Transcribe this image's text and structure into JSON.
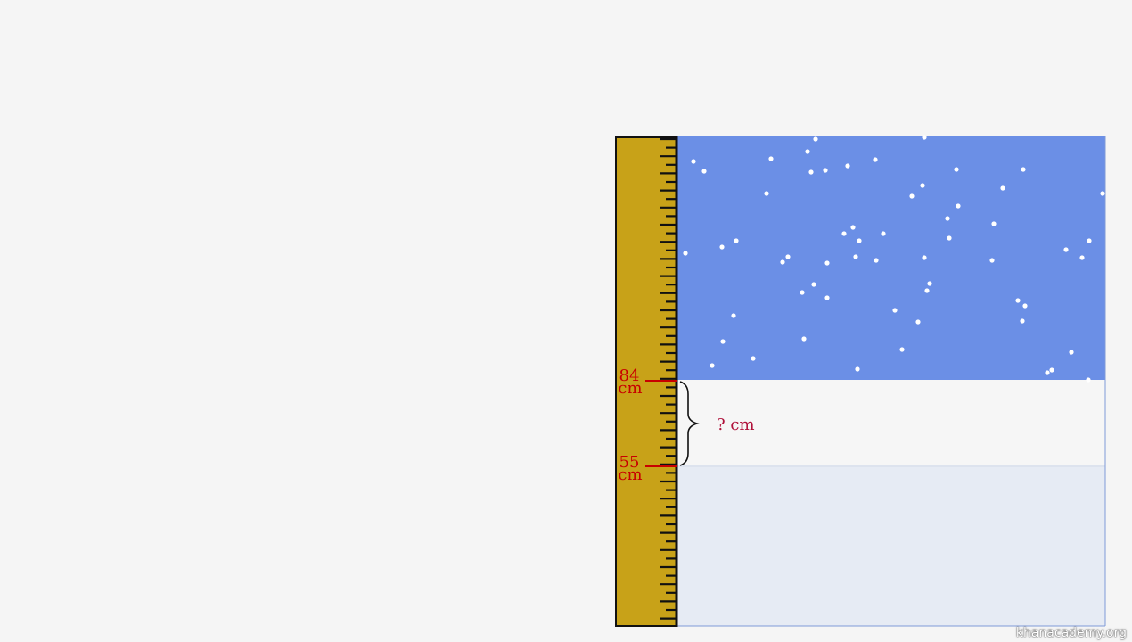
{
  "colors": {
    "background": "#f5f5f5",
    "ruler": "#c8a218",
    "ruler_edge": "#111111",
    "sky": "#6b8fe6",
    "snow_new": "#f6f6f6",
    "snow_old": "#e6ebf4",
    "snowflake": "#ffffff",
    "label_red": "#c80000",
    "question_color": "#b0113a"
  },
  "ruler": {
    "marks": [
      {
        "value": "84",
        "unit": "cm"
      },
      {
        "value": "55",
        "unit": "cm"
      }
    ]
  },
  "question": "? cm",
  "watermark": "khanacademy.org"
}
